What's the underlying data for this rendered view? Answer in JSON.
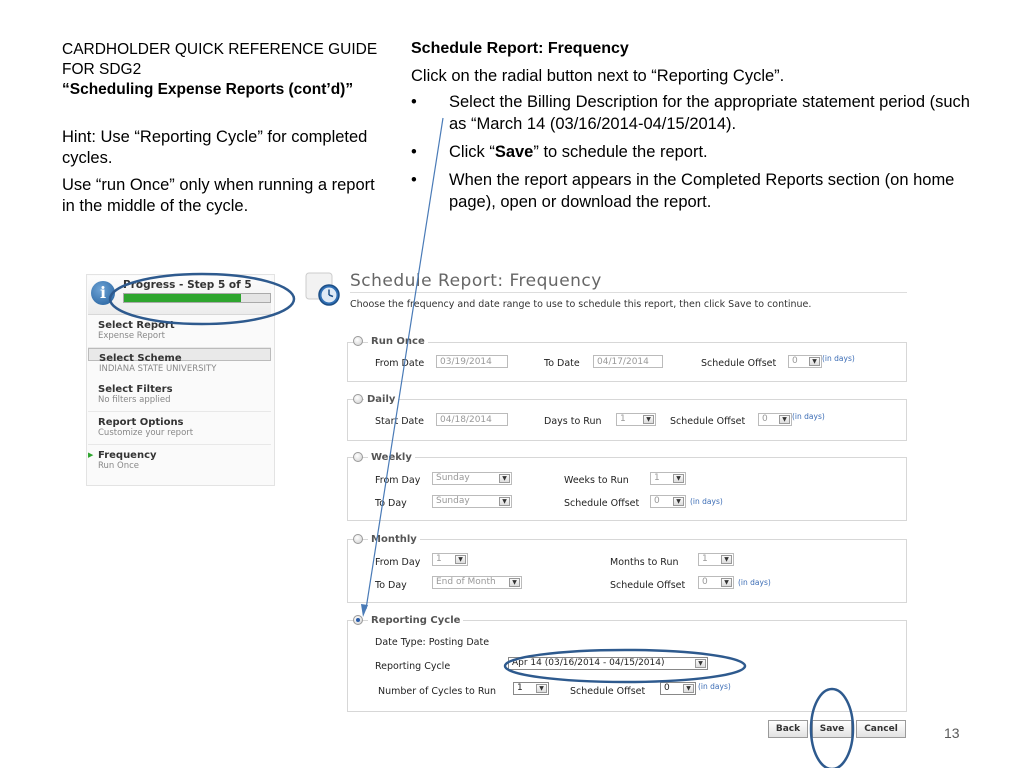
{
  "slide": {
    "guide_title_line1": "CARDHOLDER QUICK REFERENCE GUIDE",
    "guide_title_line2": "FOR SDG2",
    "guide_subtitle": "“Scheduling Expense Reports (cont’d)”",
    "hint1": "Hint: Use “Reporting Cycle” for completed cycles.",
    "hint2": "Use “run Once” only when running a report in the middle of the cycle.",
    "instr_heading": "Schedule Report: Frequency",
    "instr_intro": "Click on the radial button next to “Reporting Cycle”.",
    "bullet_char": "•",
    "bullet1": "Select the Billing Description for the appropriate statement period (such as “March 14 (03/16/2014-04/15/2014).",
    "bullet2_pre": "Click “",
    "bullet2_bold": "Save",
    "bullet2_post": "” to schedule the report.",
    "bullet3": "When the report appears in the Completed Reports section (on home page), open or download the report.",
    "page_number": "13"
  },
  "sidebar": {
    "progress_label": "Progress - Step 5 of 5",
    "progress_fraction": 0.8,
    "info_glyph": "i",
    "items": [
      {
        "title": "Select Report",
        "sub": "Expense Report"
      },
      {
        "title": "Select Scheme",
        "sub": "INDIANA STATE UNIVERSITY"
      },
      {
        "title": "Select Filters",
        "sub": "No filters applied"
      },
      {
        "title": "Report Options",
        "sub": "Customize your report"
      },
      {
        "title": "Frequency",
        "sub": "Run Once"
      }
    ]
  },
  "main": {
    "title": "Schedule Report: Frequency",
    "subtitle": "Choose the frequency and date range to use to schedule this report, then click Save to continue.",
    "in_days": "(in days)",
    "dropdown_glyph": "▼",
    "run_once": {
      "legend": "Run Once",
      "from_label": "From Date",
      "from_value": "03/19/2014",
      "to_label": "To Date",
      "to_value": "04/17/2014",
      "offset_label": "Schedule Offset",
      "offset_value": "0"
    },
    "daily": {
      "legend": "Daily",
      "start_label": "Start Date",
      "start_value": "04/18/2014",
      "days_label": "Days to Run",
      "days_value": "1",
      "offset_label": "Schedule Offset",
      "offset_value": "0"
    },
    "weekly": {
      "legend": "Weekly",
      "from_label": "From Day",
      "from_value": "Sunday",
      "to_label": "To Day",
      "to_value": "Sunday",
      "weeks_label": "Weeks to Run",
      "weeks_value": "1",
      "offset_label": "Schedule Offset",
      "offset_value": "0"
    },
    "monthly": {
      "legend": "Monthly",
      "from_label": "From Day",
      "from_value": "1",
      "to_label": "To Day",
      "to_value": "End of Month",
      "months_label": "Months to Run",
      "months_value": "1",
      "offset_label": "Schedule Offset",
      "offset_value": "0"
    },
    "reporting_cycle": {
      "legend": "Reporting Cycle",
      "date_type": "Date Type: Posting Date",
      "cycle_label": "Reporting Cycle",
      "cycle_value": "Apr 14 (03/16/2014 - 04/15/2014)",
      "cycles_label": "Number of Cycles to Run",
      "cycles_value": "1",
      "offset_label": "Schedule Offset",
      "offset_value": "0"
    },
    "buttons": {
      "back": "Back",
      "save": "Save",
      "cancel": "Cancel"
    }
  },
  "colors": {
    "annotation": "#2e5a8e",
    "progress_fill": "#2ea52e",
    "radio_selected": "#2b5da8"
  }
}
